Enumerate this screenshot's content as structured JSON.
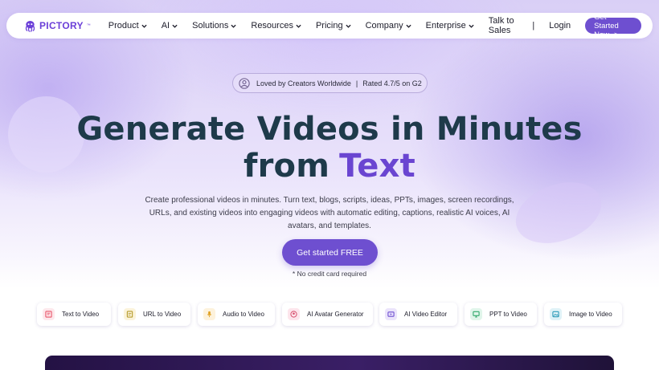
{
  "nav": {
    "logo_text": "PICTORY",
    "logo_tm": "™",
    "menu": [
      {
        "label": "Product"
      },
      {
        "label": "AI"
      },
      {
        "label": "Solutions"
      },
      {
        "label": "Resources"
      },
      {
        "label": "Pricing"
      },
      {
        "label": "Company"
      },
      {
        "label": "Enterprise"
      }
    ],
    "talk_to_sales": "Talk to Sales",
    "separator": "|",
    "login": "Login",
    "cta": "Get Started Now ->"
  },
  "badge": {
    "left_text": "Loved by Creators Worldwide",
    "separator": "|",
    "right_text": "Rated 4.7/5 on G2"
  },
  "hero": {
    "line1": "Generate Videos in Minutes",
    "line2_plain": "from",
    "line2_accent": "Text",
    "description": "Create professional videos in minutes. Turn text, blogs, scripts, ideas, PPTs, images, screen recordings, URLs, and existing videos into engaging videos with automatic editing, captions, realistic AI voices, AI avatars, and templates.",
    "cta": "Get started FREE",
    "note": "* No credit card required"
  },
  "features": [
    {
      "label": "Text to Video",
      "icon": "text-video-icon",
      "color": "#e8566a",
      "bg": "#fde8ec"
    },
    {
      "label": "URL to Video",
      "icon": "url-doc-icon",
      "color": "#b59a2a",
      "bg": "#fbf3da"
    },
    {
      "label": "Audio to Video",
      "icon": "microphone-icon",
      "color": "#e0a020",
      "bg": "#fdf2dc"
    },
    {
      "label": "AI Avatar Generator",
      "icon": "avatar-icon",
      "color": "#d64b6a",
      "bg": "#fde5ec"
    },
    {
      "label": "AI Video Editor",
      "icon": "video-editor-icon",
      "color": "#6e4fd0",
      "bg": "#ebe4fb"
    },
    {
      "label": "PPT to Video",
      "icon": "presentation-icon",
      "color": "#2fa86a",
      "bg": "#e0f5ea"
    },
    {
      "label": "Image to Video",
      "icon": "image-icon",
      "color": "#2b9ab8",
      "bg": "#dff2f7"
    }
  ],
  "colors": {
    "accent": "#6e4fd0",
    "title": "#1e3a4a",
    "accent_text": "#6a45d1"
  }
}
